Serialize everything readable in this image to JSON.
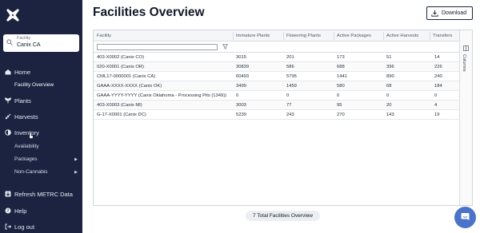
{
  "sidebar": {
    "facility_label": "Facility",
    "facility_value": "Canix CA",
    "nav": {
      "home": "Home",
      "facility_overview": "Facility Overview",
      "plants": "Plants",
      "harvests": "Harvests",
      "inventory": "Inventory",
      "availability": "Availability",
      "packages": "Packages",
      "non_cannabis": "Non-Cannabis",
      "refresh": "Refresh METRC Data",
      "help": "Help",
      "logout": "Log out"
    }
  },
  "header": {
    "title": "Facilities Overview",
    "download_label": "Download"
  },
  "grid": {
    "columns": [
      "Facility",
      "Immature Plants",
      "Flowering Plants",
      "Active Packages",
      "Active Harvests",
      "Transfers"
    ],
    "rows": [
      [
        "403-X0002 (Canix CO)",
        "3015",
        "201",
        "173",
        "51",
        "14"
      ],
      [
        "020-X0001 (Canix OR)",
        "30839",
        "586",
        "688",
        "396",
        "226"
      ],
      [
        "CML17-0000001 (Canix CA)",
        "60493",
        "5795",
        "1441",
        "890",
        "240"
      ],
      [
        "GAAA-XXXX-XXXX (Canix OK)",
        "3499",
        "1459",
        "580",
        "68",
        "184"
      ],
      [
        "GAAA-YYYY-YYYY (Canix Oklahoma - Processing Pits (1349))",
        "0",
        "0",
        "0",
        "0",
        "0"
      ],
      [
        "403-X0003 (Canix MI)",
        "3003",
        "77",
        "95",
        "20",
        "4"
      ],
      [
        "G-17-X0001 (Canix DC)",
        "5239",
        "243",
        "270",
        "143",
        "19"
      ]
    ],
    "side_panel_label": "Columns",
    "total_label": "7 Total Facilities Overview"
  },
  "colors": {
    "sidebar_bg": "#1b2340",
    "accent": "#4a73c9"
  }
}
